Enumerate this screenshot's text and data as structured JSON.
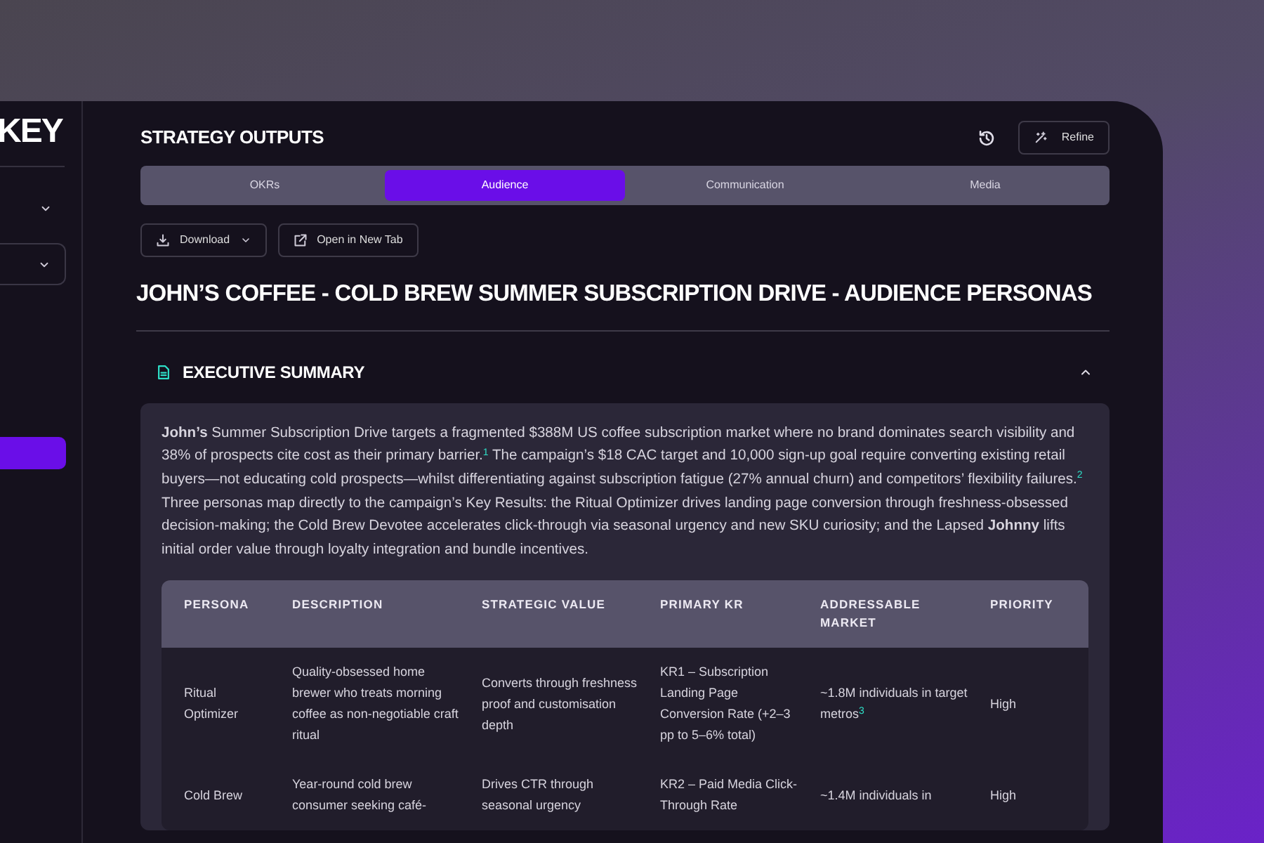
{
  "sidebar": {
    "logo": "KEY",
    "dropdowns": [
      {
        "expanded": false
      },
      {
        "expanded": false
      }
    ]
  },
  "header": {
    "title": "STRATEGY OUTPUTS",
    "refine_label": "Refine"
  },
  "tabs": [
    {
      "label": "OKRs",
      "selected": false
    },
    {
      "label": "Audience",
      "selected": true
    },
    {
      "label": "Communication",
      "selected": false
    },
    {
      "label": "Media",
      "selected": false
    }
  ],
  "actions": [
    {
      "kind": "dropdown",
      "label": "Download"
    },
    {
      "kind": "external",
      "label": "Open in New Tab"
    }
  ],
  "document_title": "JOHN’S COFFEE - COLD BREW SUMMER SUBSCRIPTION DRIVE - AUDIENCE PERSONAS",
  "section": {
    "title": "EXECUTIVE SUMMARY",
    "expanded": true,
    "summary": "**John’s** Summer Subscription Drive targets a fragmented $388M US coffee subscription market where no brand dominates search visibility and 38% of prospects cite cost as their primary barrier.$^{1}$ The campaign’s $18 CAC target and 10,000 sign-up goal require converting existing retail buyers—not educating cold prospects—whilst differentiating against subscription fatigue (27% annual churn) and competitors’ flexibility failures.$^{2}$ Three personas map directly to the campaign’s Key Results: the Ritual Optimizer drives landing page conversion through freshness-obsessed decision-making; the Cold Brew Devotee accelerates click-through via seasonal urgency and new SKU curiosity; and the Lapsed **Johnny** lifts initial order value through loyalty integration and bundle incentives.",
    "table": {
      "columns": [
        "PERSONA",
        "DESCRIPTION",
        "STRATEGIC VALUE",
        "PRIMARY KR",
        "ADDRESSABLE MARKET",
        "PRIORITY"
      ],
      "rows": [
        [
          "Ritual Optimizer",
          "Quality-obsessed home brewer who treats morning coffee as non-negotiable craft ritual",
          "Converts through freshness proof and customisation depth",
          "KR1 – Subscription Landing Page Conversion Rate (+2–3 pp to 5–6% total)",
          "~1.8M individuals in target metros$^{3}$",
          "High"
        ],
        [
          "Cold Brew",
          "Year-round cold brew consumer seeking café-",
          "Drives CTR through seasonal urgency",
          "KR2 – Paid Media Click-Through Rate",
          "~1.4M individuals in",
          "High"
        ]
      ]
    }
  }
}
